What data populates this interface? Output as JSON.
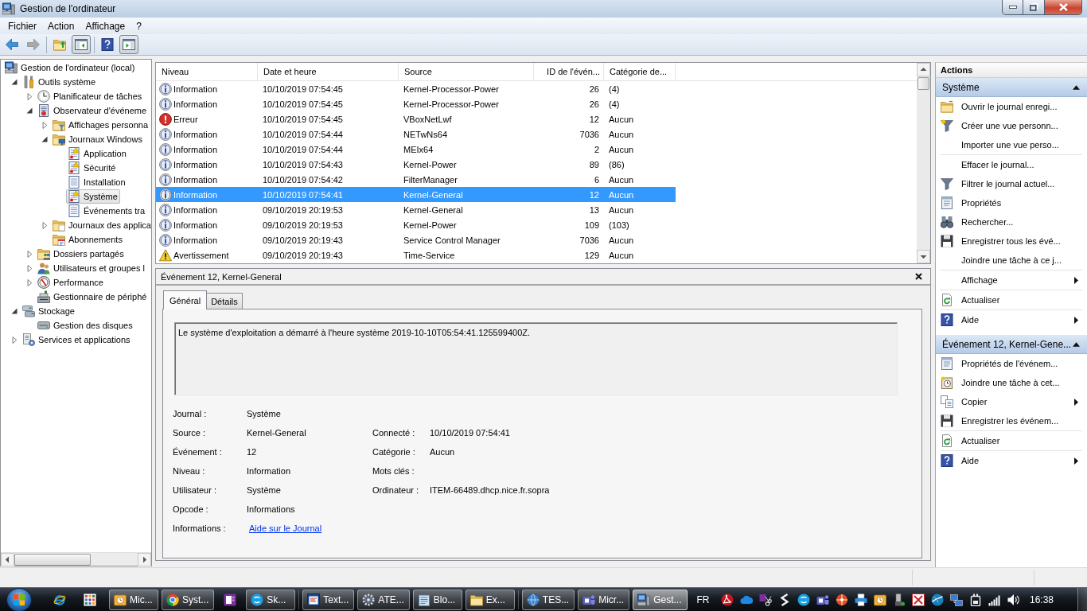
{
  "window": {
    "title": "Gestion de l'ordinateur"
  },
  "menu": [
    {
      "label": "Fichier"
    },
    {
      "label": "Action"
    },
    {
      "label": "Affichage"
    },
    {
      "label": "?"
    }
  ],
  "toolbar": [
    [
      {
        "kind": "back",
        "disabled": false,
        "pressed": false
      },
      {
        "kind": "forward",
        "disabled": true,
        "pressed": false
      }
    ],
    [
      {
        "kind": "folder-up",
        "disabled": false,
        "pressed": false
      },
      {
        "kind": "tree-pane",
        "disabled": false,
        "pressed": true
      }
    ],
    [
      {
        "kind": "help",
        "disabled": false,
        "pressed": false
      },
      {
        "kind": "action-pane",
        "disabled": false,
        "pressed": true
      }
    ]
  ],
  "tree": [
    {
      "label": "Gestion de l'ordinateur (local)",
      "kind": "computer",
      "expandable": false,
      "selected": false,
      "children": [
        {
          "label": "Outils système",
          "kind": "tools",
          "expandable": true,
          "expanded": true,
          "selected": false,
          "children": [
            {
              "label": "Planificateur de tâches",
              "kind": "clock",
              "expandable": true,
              "expanded": false,
              "selected": false
            },
            {
              "label": "Observateur d'événeme",
              "kind": "event-viewer",
              "expandable": true,
              "expanded": true,
              "selected": false,
              "children": [
                {
                  "label": "Affichages personna",
                  "kind": "filter-folder",
                  "expandable": true,
                  "expanded": false,
                  "selected": false
                },
                {
                  "label": "Journaux Windows",
                  "kind": "windows-folder",
                  "expandable": true,
                  "expanded": true,
                  "selected": false,
                  "children": [
                    {
                      "label": "Application",
                      "kind": "log-warning",
                      "expandable": false,
                      "selected": false
                    },
                    {
                      "label": "Sécurité",
                      "kind": "log-warning",
                      "expandable": false,
                      "selected": false
                    },
                    {
                      "label": "Installation",
                      "kind": "log",
                      "expandable": false,
                      "selected": false
                    },
                    {
                      "label": "Système",
                      "kind": "log-warning",
                      "expandable": false,
                      "selected": true
                    },
                    {
                      "label": "Événements tra",
                      "kind": "log",
                      "expandable": false,
                      "selected": false
                    }
                  ]
                },
                {
                  "label": "Journaux des applica",
                  "kind": "folder",
                  "expandable": true,
                  "expanded": false,
                  "selected": false
                },
                {
                  "label": "Abonnements",
                  "kind": "subscriptions",
                  "expandable": false,
                  "selected": false
                }
              ]
            },
            {
              "label": "Dossiers partagés",
              "kind": "shared-folder",
              "expandable": true,
              "expanded": false,
              "selected": false
            },
            {
              "label": "Utilisateurs et groupes l",
              "kind": "users",
              "expandable": true,
              "expanded": false,
              "selected": false
            },
            {
              "label": "Performance",
              "kind": "performance",
              "expandable": true,
              "expanded": false,
              "selected": false
            },
            {
              "label": "Gestionnaire de périphé",
              "kind": "device-manager",
              "expandable": false,
              "selected": false
            }
          ]
        },
        {
          "label": "Stockage",
          "kind": "storage",
          "expandable": true,
          "expanded": true,
          "selected": false,
          "children": [
            {
              "label": "Gestion des disques",
              "kind": "disk",
              "expandable": false,
              "selected": false
            }
          ]
        },
        {
          "label": "Services et applications",
          "kind": "services",
          "expandable": true,
          "expanded": false,
          "selected": false
        }
      ]
    }
  ],
  "event_list": {
    "columns": [
      "Niveau",
      "Date et heure",
      "Source",
      "ID de l'évén...",
      "Catégorie de..."
    ],
    "rows": [
      {
        "kind": "information",
        "level_text": "Information",
        "date": "10/10/2019 07:54:45",
        "source": "Kernel-Processor-Power",
        "event_id": "26",
        "category": "(4)",
        "selected": false
      },
      {
        "kind": "information",
        "level_text": "Information",
        "date": "10/10/2019 07:54:45",
        "source": "Kernel-Processor-Power",
        "event_id": "26",
        "category": "(4)",
        "selected": false
      },
      {
        "kind": "error",
        "level_text": "Erreur",
        "date": "10/10/2019 07:54:45",
        "source": "VBoxNetLwf",
        "event_id": "12",
        "category": "Aucun",
        "selected": false
      },
      {
        "kind": "information",
        "level_text": "Information",
        "date": "10/10/2019 07:54:44",
        "source": "NETwNs64",
        "event_id": "7036",
        "category": "Aucun",
        "selected": false
      },
      {
        "kind": "information",
        "level_text": "Information",
        "date": "10/10/2019 07:54:44",
        "source": "MEIx64",
        "event_id": "2",
        "category": "Aucun",
        "selected": false
      },
      {
        "kind": "information",
        "level_text": "Information",
        "date": "10/10/2019 07:54:43",
        "source": "Kernel-Power",
        "event_id": "89",
        "category": "(86)",
        "selected": false
      },
      {
        "kind": "information",
        "level_text": "Information",
        "date": "10/10/2019 07:54:42",
        "source": "FilterManager",
        "event_id": "6",
        "category": "Aucun",
        "selected": false
      },
      {
        "kind": "information",
        "level_text": "Information",
        "date": "10/10/2019 07:54:41",
        "source": "Kernel-General",
        "event_id": "12",
        "category": "Aucun",
        "selected": true
      },
      {
        "kind": "information",
        "level_text": "Information",
        "date": "09/10/2019 20:19:53",
        "source": "Kernel-General",
        "event_id": "13",
        "category": "Aucun",
        "selected": false
      },
      {
        "kind": "information",
        "level_text": "Information",
        "date": "09/10/2019 20:19:53",
        "source": "Kernel-Power",
        "event_id": "109",
        "category": "(103)",
        "selected": false
      },
      {
        "kind": "information",
        "level_text": "Information",
        "date": "09/10/2019 20:19:43",
        "source": "Service Control Manager",
        "event_id": "7036",
        "category": "Aucun",
        "selected": false
      },
      {
        "kind": "warning",
        "level_text": "Avertissement",
        "date": "09/10/2019 20:19:43",
        "source": "Time-Service",
        "event_id": "129",
        "category": "Aucun",
        "selected": false
      }
    ]
  },
  "event_details": {
    "title": "Événement 12, Kernel-General",
    "tabs": [
      {
        "label": "Général",
        "selected": true
      },
      {
        "label": "Détails",
        "selected": false
      }
    ],
    "message": "Le système d'exploitation a démarré à l'heure système 2019-10-10T05:54:41.125599400Z.",
    "fields": [
      {
        "label": "Journal :",
        "value": "Système",
        "kind": "text"
      },
      {
        "label": "Source :",
        "value": "Kernel-General",
        "kind": "text"
      },
      {
        "label": "Événement :",
        "value": "12",
        "kind": "text"
      },
      {
        "label": "Niveau :",
        "value": "Information",
        "kind": "text"
      },
      {
        "label": "Utilisateur :",
        "value": "Système",
        "kind": "text"
      },
      {
        "label": "Opcode :",
        "value": "Informations",
        "kind": "text"
      },
      {
        "label": "Informations :",
        "value": "Aide sur le Journal",
        "kind": "link"
      }
    ],
    "fields_right": [
      {
        "label": "Connecté :",
        "value": "10/10/2019 07:54:41"
      },
      {
        "label": "Catégorie :",
        "value": "Aucun"
      },
      {
        "label": "Mots clés :"
      },
      {
        "label": "Ordinateur :",
        "value": "ITEM-66489.dhcp.nice.fr.sopra"
      }
    ]
  },
  "actions": {
    "title": "Actions",
    "sections": [
      {
        "title": "Système",
        "expanded": true,
        "groups": [
          [
            {
              "kind": "open-folder",
              "label": "Ouvrir le journal enregi...",
              "submenu": false
            },
            {
              "kind": "filter-star",
              "label": "Créer une vue personn...",
              "submenu": false
            },
            {
              "kind": "none",
              "label": "Importer une vue perso...",
              "submenu": false
            }
          ],
          [
            {
              "kind": "none",
              "label": "Effacer le journal...",
              "submenu": false
            },
            {
              "kind": "filter",
              "label": "Filtrer le journal actuel...",
              "submenu": false
            },
            {
              "kind": "properties",
              "label": "Propriétés",
              "submenu": false
            },
            {
              "kind": "binoculars",
              "label": "Rechercher...",
              "submenu": false
            },
            {
              "kind": "save",
              "label": "Enregistrer tous les évé...",
              "submenu": false
            },
            {
              "kind": "none",
              "label": "Joindre une tâche à ce j...",
              "submenu": false
            }
          ],
          [
            {
              "kind": "none",
              "label": "Affichage",
              "submenu": true
            }
          ],
          [
            {
              "kind": "refresh",
              "label": "Actualiser",
              "submenu": false
            }
          ],
          [
            {
              "kind": "help",
              "label": "Aide",
              "submenu": true
            }
          ]
        ]
      },
      {
        "title": "Événement 12, Kernel-Gene...",
        "expanded": true,
        "groups": [
          [
            {
              "kind": "properties",
              "label": "Propriétés de l'événem...",
              "submenu": false
            },
            {
              "kind": "task-clock",
              "label": "Joindre une tâche à cet...",
              "submenu": false
            },
            {
              "kind": "copy",
              "label": "Copier",
              "submenu": true
            },
            {
              "kind": "save",
              "label": "Enregistrer les événem...",
              "submenu": false
            }
          ],
          [
            {
              "kind": "refresh",
              "label": "Actualiser",
              "submenu": false
            }
          ],
          [
            {
              "kind": "help",
              "label": "Aide",
              "submenu": true
            }
          ]
        ]
      }
    ]
  },
  "taskbar": {
    "pinned": [
      {
        "kind": "ie"
      },
      {
        "kind": "grid"
      }
    ],
    "groups": [
      [
        {
          "kind": "outlook",
          "label": "Mic...",
          "selected": false
        },
        {
          "kind": "chrome",
          "label": "Syst...",
          "selected": false
        },
        {
          "kind": "onenote",
          "selected": false
        },
        {
          "kind": "skype",
          "label": "Sk...",
          "selected": false
        }
      ],
      [
        {
          "kind": "editor",
          "label": "Text...",
          "selected": false
        },
        {
          "kind": "gear",
          "label": "ATE...",
          "selected": false
        },
        {
          "kind": "notepad",
          "label": "Blo...",
          "selected": false
        },
        {
          "kind": "explorer",
          "label": "Ex...",
          "selected": false
        }
      ],
      [
        {
          "kind": "globe",
          "label": "TES...",
          "selected": false
        },
        {
          "kind": "teams",
          "label": "Micr...",
          "selected": false
        },
        {
          "kind": "computer",
          "label": "Gest...",
          "selected": true
        }
      ]
    ],
    "language": "FR",
    "tray": [
      {
        "kind": "acrobat"
      },
      {
        "kind": "cloud"
      },
      {
        "kind": "clip"
      },
      {
        "kind": "zigzag"
      },
      {
        "kind": "skype"
      },
      {
        "kind": "teams"
      },
      {
        "kind": "pinwheel"
      },
      {
        "kind": "printer"
      },
      {
        "kind": "outlook"
      },
      {
        "kind": "usb"
      },
      {
        "kind": "cross-box"
      },
      {
        "kind": "globe-arrow"
      },
      {
        "kind": "network"
      },
      {
        "kind": "plug"
      },
      {
        "kind": "signal"
      },
      {
        "kind": "speaker"
      }
    ],
    "clock": "16:38"
  }
}
